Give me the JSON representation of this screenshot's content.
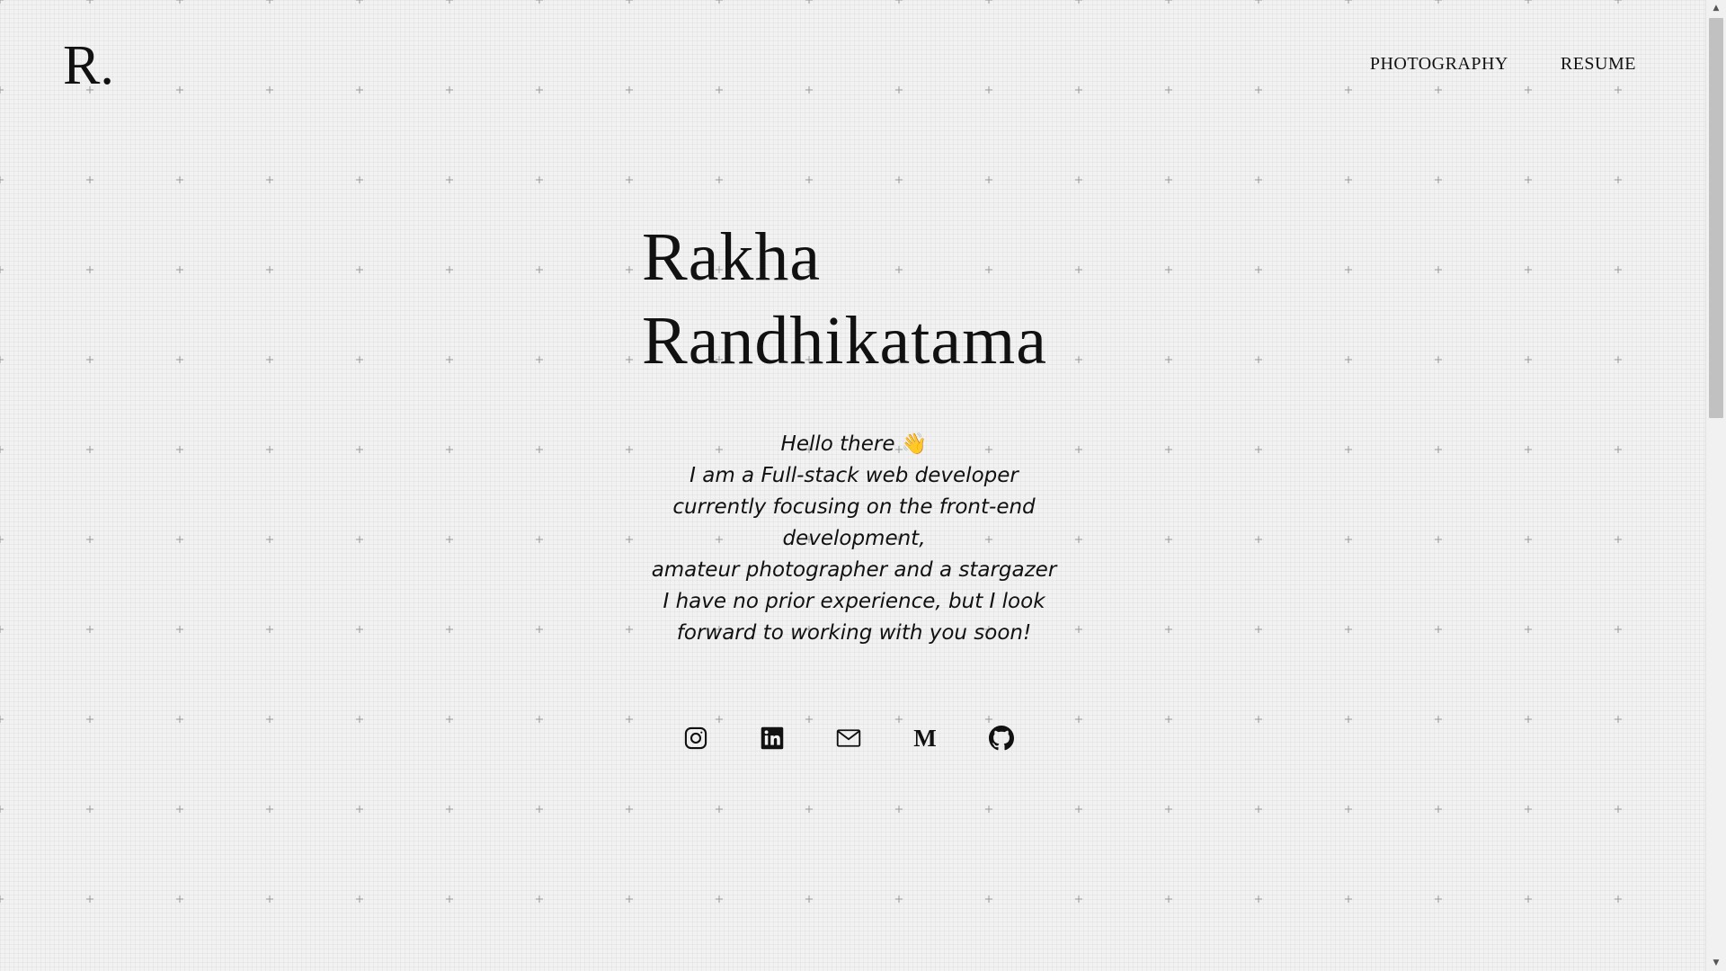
{
  "header": {
    "logo": "R.",
    "nav": [
      {
        "label": "PHOTOGRAPHY"
      },
      {
        "label": "RESUME"
      }
    ]
  },
  "hero": {
    "name_first": "Rakha",
    "name_last": "Randhikatama",
    "intro_lines": [
      "Hello there",
      "I am a Full-stack web developer",
      "currently focusing on the front-end",
      "development,",
      "amateur photographer and a stargazer",
      "I have no prior experience, but I look",
      "forward to working with you soon!"
    ],
    "wave_emoji": "👋"
  },
  "socials": [
    {
      "icon": "instagram-icon"
    },
    {
      "icon": "linkedin-icon"
    },
    {
      "icon": "mail-icon"
    },
    {
      "icon": "medium-icon",
      "glyph": "M"
    },
    {
      "icon": "github-icon"
    }
  ],
  "colors": {
    "background": "#f2f2f2",
    "text": "#111111"
  }
}
